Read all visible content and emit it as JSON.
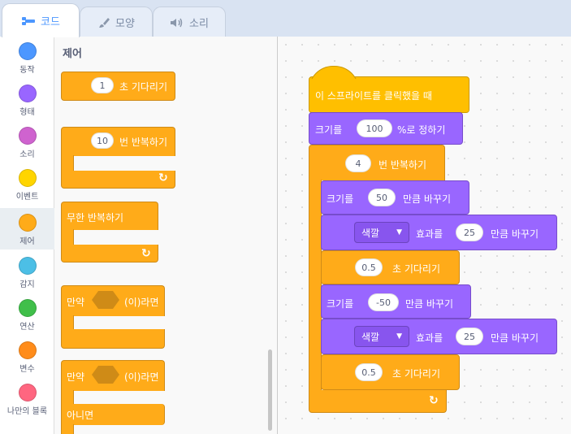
{
  "tabs": [
    {
      "label": "코드"
    },
    {
      "label": "모양"
    },
    {
      "label": "소리"
    }
  ],
  "categories": [
    {
      "label": "동작",
      "color": "#4c97ff"
    },
    {
      "label": "형태",
      "color": "#9966ff"
    },
    {
      "label": "소리",
      "color": "#cf63cf"
    },
    {
      "label": "이벤트",
      "color": "#ffd500"
    },
    {
      "label": "제어",
      "color": "#ffab19"
    },
    {
      "label": "감지",
      "color": "#4cbfe6"
    },
    {
      "label": "연산",
      "color": "#40bf4a"
    },
    {
      "label": "변수",
      "color": "#ff8c1a"
    },
    {
      "label": "나만의 블록",
      "color": "#ff6680"
    }
  ],
  "palette": {
    "title": "제어",
    "wait": {
      "value": "1",
      "label": "초 기다리기"
    },
    "repeat": {
      "value": "10",
      "label": "번 반복하기"
    },
    "forever": {
      "label": "무한 반복하기"
    },
    "if_then": {
      "prefix": "만약",
      "suffix": "(이)라면"
    },
    "if_else": {
      "prefix": "만약",
      "suffix": "(이)라면",
      "else": "아니면"
    }
  },
  "script": {
    "hat": "이 스프라이트를 클릭했을 때",
    "set_size": {
      "prefix": "크기를",
      "value": "100",
      "suffix": "%로 정하기"
    },
    "repeat": {
      "value": "4",
      "label": "번 반복하기"
    },
    "change_size_1": {
      "prefix": "크기를",
      "value": "50",
      "suffix": "만큼 바꾸기"
    },
    "change_effect_1": {
      "effect": "색깔",
      "middle": "효과를",
      "value": "25",
      "suffix": "만큼 바꾸기"
    },
    "wait_1": {
      "value": "0.5",
      "label": "초 기다리기"
    },
    "change_size_2": {
      "prefix": "크기를",
      "value": "-50",
      "suffix": "만큼 바꾸기"
    },
    "change_effect_2": {
      "effect": "색깔",
      "middle": "효과를",
      "value": "25",
      "suffix": "만큼 바꾸기"
    },
    "wait_2": {
      "value": "0.5",
      "label": "초 기다리기"
    }
  },
  "icons": {
    "code_tab": "code-icon",
    "costume_tab": "brush-icon",
    "sound_tab": "speaker-icon",
    "loop_arrow": "loop-arrow-icon",
    "dropdown": "caret-down-icon"
  }
}
